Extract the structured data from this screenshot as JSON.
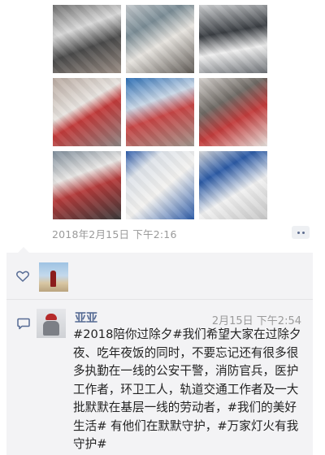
{
  "post": {
    "photos": [
      {
        "name": "volunteers-making-dumplings-1"
      },
      {
        "name": "volunteers-making-dumplings-2"
      },
      {
        "name": "volunteers-making-dumplings-3"
      },
      {
        "name": "volunteers-making-dumplings-4"
      },
      {
        "name": "volunteers-making-dumplings-5"
      },
      {
        "name": "volunteers-making-dumplings-6"
      },
      {
        "name": "volunteers-making-dumplings-7"
      },
      {
        "name": "trays-of-dumplings"
      },
      {
        "name": "dumplings-on-tables"
      }
    ],
    "timestamp": "2018年2月15日 下午2:16",
    "more_icon": "more-dots-icon"
  },
  "likes": {
    "icon": "heart-icon"
  },
  "comment": {
    "icon": "comment-icon",
    "author": "亚亚",
    "time": "2月15日 下午2:54",
    "text": "#2018陪你过除夕#我们希望大家在过除夕夜、吃年夜饭的同时，不要忘记还有很多很多执勤在一线的公安干警，消防官兵，医护工作者，环卫工人，轨道交通工作者及一大批默默在基层一线的劳动者，#我们的美好生活# 有他们在默默守护，#万家灯火有我守护#"
  },
  "colors": {
    "link": "#566b94",
    "panel": "#f3f3f5",
    "muted": "#9a9a9a"
  }
}
